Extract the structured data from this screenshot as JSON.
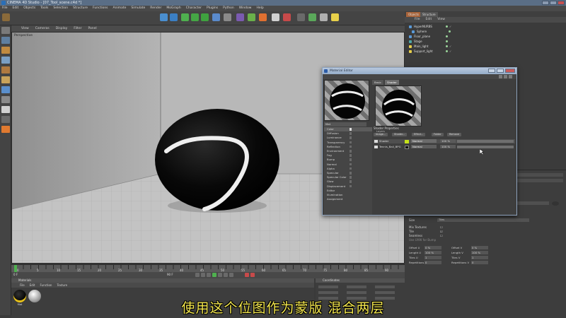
{
  "window": {
    "title": "CINEMA 4D Studio - [07_Tool_scene.c4d *]"
  },
  "main_menu": [
    "File",
    "Edit",
    "Objects",
    "Tools",
    "Selection",
    "Structure",
    "Functions",
    "Animate",
    "Simulate",
    "Render",
    "MoGraph",
    "Character",
    "Plugins",
    "Python",
    "Window",
    "Help"
  ],
  "viewport": {
    "menu": [
      "View",
      "Cameras",
      "Display",
      "Filter",
      "Panel"
    ],
    "label": "Perspective"
  },
  "timeline": {
    "start": "0",
    "ticks": [
      "0",
      "5",
      "10",
      "15",
      "20",
      "25",
      "30",
      "35",
      "40",
      "45",
      "50",
      "55",
      "60",
      "65",
      "70",
      "75",
      "80",
      "85",
      "90"
    ],
    "current": "0 F",
    "end": "90 F"
  },
  "materials": {
    "title": "Materials",
    "menu": [
      "File",
      "Edit",
      "Function",
      "Texture"
    ],
    "items": [
      {
        "label": "Mat"
      },
      {
        "label": ""
      }
    ]
  },
  "coordinates": {
    "title": "Coordinates"
  },
  "object_manager": {
    "tabs": [
      "Objects",
      "Structure"
    ],
    "menu": [
      "File",
      "Edit",
      "View"
    ],
    "objects": [
      {
        "label": "HyperNURBS"
      },
      {
        "label": "Sphere"
      },
      {
        "label": "Floor_plane"
      },
      {
        "label": "Stage"
      },
      {
        "label": "Main_light"
      },
      {
        "label": "Support_light"
      }
    ]
  },
  "attributes": {
    "size_label": "Size",
    "size_value": "Tiles",
    "rows": [
      {
        "label": "Mix Textures",
        "value": ""
      },
      {
        "label": "Tile",
        "value": ""
      },
      {
        "label": "Seamless",
        "value": ""
      },
      {
        "label": "Use UVW for Bump",
        "value": ""
      }
    ],
    "grid": [
      {
        "label": "Offset U",
        "value": "0 %"
      },
      {
        "label": "Offset V",
        "value": "0 %"
      },
      {
        "label": "Length U",
        "value": "100 %"
      },
      {
        "label": "Length V",
        "value": "100 %"
      },
      {
        "label": "Tiles U",
        "value": "1"
      },
      {
        "label": "Tiles V",
        "value": "1"
      },
      {
        "label": "Repetitions U",
        "value": "0"
      },
      {
        "label": "Repetitions V",
        "value": "0"
      }
    ]
  },
  "material_editor": {
    "title": "Material Editor",
    "shader_tabs": [
      "Basic",
      "Shader"
    ],
    "name_field": "Mat",
    "channels": [
      {
        "label": "Color",
        "checked": true
      },
      {
        "label": "Diffusion",
        "checked": false
      },
      {
        "label": "Luminance",
        "checked": false
      },
      {
        "label": "Transparency",
        "checked": false
      },
      {
        "label": "Reflection",
        "checked": false
      },
      {
        "label": "Environment",
        "checked": false
      },
      {
        "label": "Fog",
        "checked": false
      },
      {
        "label": "Bump",
        "checked": false
      },
      {
        "label": "Normal",
        "checked": false
      },
      {
        "label": "Alpha",
        "checked": false
      },
      {
        "label": "Specular",
        "checked": false
      },
      {
        "label": "Specular Color",
        "checked": false
      },
      {
        "label": "Glow",
        "checked": false
      },
      {
        "label": "Displacement",
        "checked": false
      },
      {
        "label": "Editor",
        "checked": false
      },
      {
        "label": "Illumination",
        "checked": false
      },
      {
        "label": "Assignment",
        "checked": false
      }
    ],
    "section_title": "Shader Properties",
    "layers_label": "Layers",
    "layer_buttons": [
      "Image...",
      "Shader...",
      "Effect...",
      "Folder",
      "Remove"
    ],
    "layers": [
      {
        "name": "Shader",
        "swatch": "#c6e21a",
        "mode": "Normal",
        "percent": "100 %"
      },
      {
        "name": "Tennis_Ball_BPG",
        "swatch": "#111111",
        "mode": "Normal",
        "percent": "100 %"
      }
    ]
  },
  "subtitle": "使用这个位图作为蒙版 混合两层",
  "colors": {
    "accent_green": "#4fb04f",
    "layer_yellow": "#c6e21a",
    "subtitle_yellow": "#f3e64e"
  }
}
